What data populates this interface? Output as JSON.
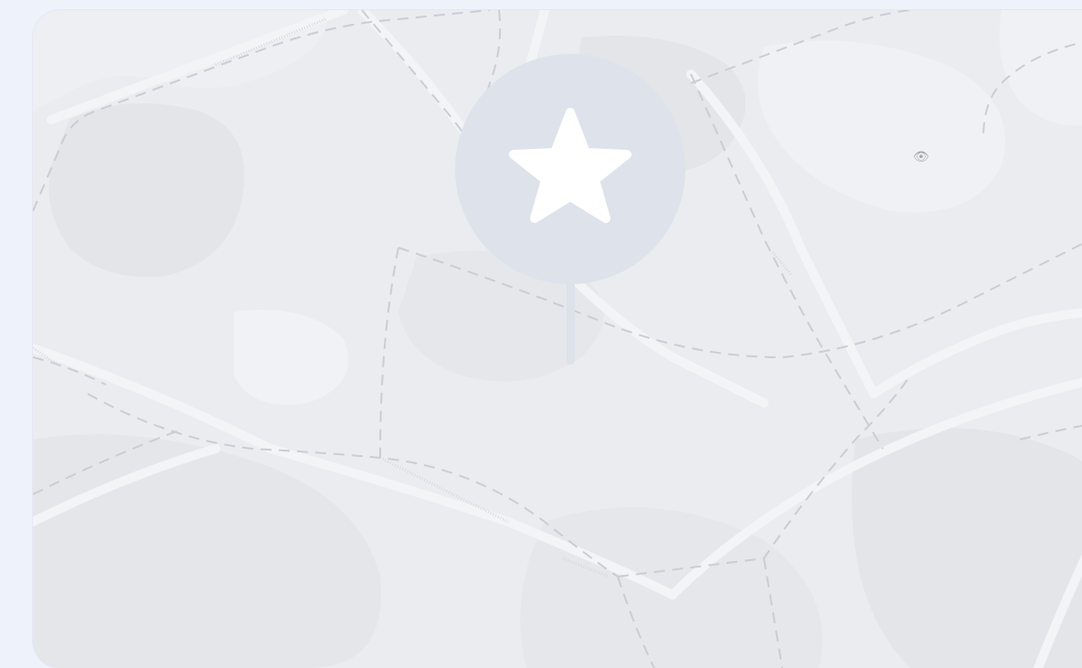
{
  "map": {
    "theme_colors": {
      "background": "#eef2fa",
      "land": "#ebecf0",
      "land_light": "#f1f2f5",
      "land_dark": "#e4e5e9",
      "road": "#f3f4f6",
      "dashed_road": "#c9cbd1",
      "pin_white": "#ffffff",
      "avatar_gray": "#dfe2ea",
      "featured_circle": "#dee2ea"
    },
    "landmark_icon": "binoculars-icon",
    "featured_pin": {
      "icon": "star-icon"
    },
    "people_pins": [
      {
        "icon": "user-icon"
      },
      {
        "icon": "user-icon"
      },
      {
        "icon": "user-icon"
      },
      {
        "icon": "user-icon"
      },
      {
        "icon": "user-icon"
      },
      {
        "icon": "user-icon"
      }
    ]
  }
}
